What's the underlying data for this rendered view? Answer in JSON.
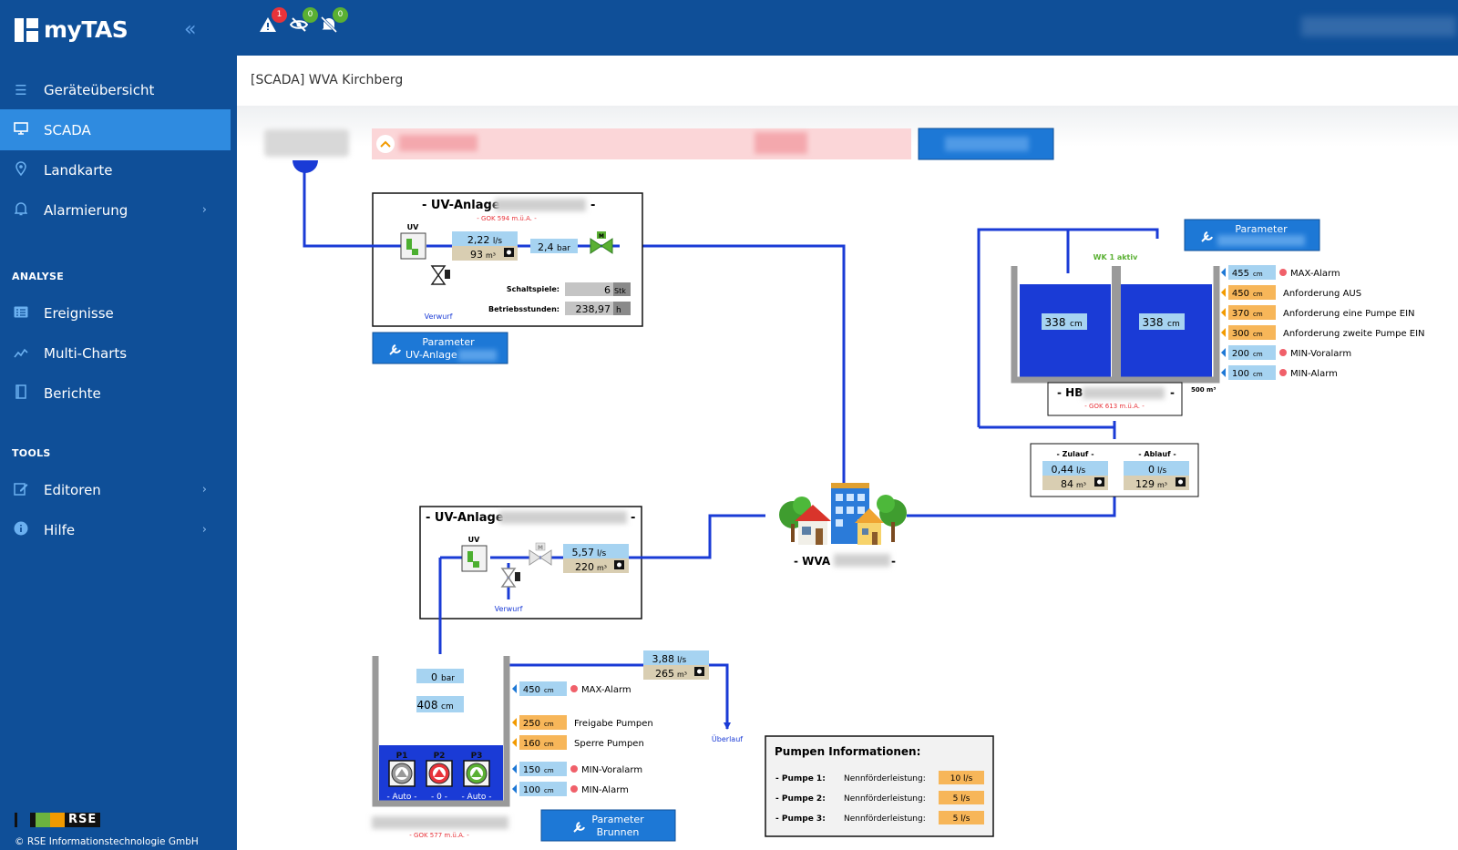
{
  "app": {
    "name": "myTAS"
  },
  "nav": {
    "items": [
      {
        "label": "Geräteübersicht"
      },
      {
        "label": "SCADA"
      },
      {
        "label": "Landkarte"
      },
      {
        "label": "Alarmierung"
      }
    ],
    "analyse_header": "ANALYSE",
    "analyse_items": [
      {
        "label": "Ereignisse"
      },
      {
        "label": "Multi-Charts"
      },
      {
        "label": "Berichte"
      }
    ],
    "tools_header": "TOOLS",
    "tools_items": [
      {
        "label": "Editoren"
      },
      {
        "label": "Hilfe"
      }
    ]
  },
  "footer": {
    "logo_text": "RSE",
    "copyright": "© RSE Informationstechnologie GmbH"
  },
  "topbar": {
    "alarm_count": "1",
    "hidden_count": "0",
    "muted_count": "0"
  },
  "page": {
    "title": "[SCADA] WVA Kirchberg"
  },
  "colors": {
    "brand": "#0f4f98",
    "active": "#2f8be0",
    "pipe": "#1a3bd6",
    "water": "#1a3bd6"
  },
  "uv1": {
    "title": "- UV-Anlage",
    "gok": "- GOK 594 m.ü.A. -",
    "uv_label": "UV",
    "flow": "2,22",
    "flow_unit": "l/s",
    "volume": "93",
    "volume_unit": "m³",
    "pressure": "2,4",
    "pressure_unit": "bar",
    "valve_label": "M",
    "verwurf": "Verwurf",
    "schaltspiele_label": "Schaltspiele:",
    "schaltspiele": "6",
    "schaltspiele_unit": "Stk",
    "betriebsstunden_label": "Betriebsstunden:",
    "betriebsstunden": "238,97",
    "betriebsstunden_unit": "h",
    "param_line1": "Parameter",
    "param_line2": "UV-Anlage"
  },
  "uv2": {
    "title": "- UV-Anlage",
    "uv_label": "UV",
    "valve_label": "M",
    "flow": "5,57",
    "flow_unit": "l/s",
    "volume": "220",
    "volume_unit": "m³",
    "verwurf": "Verwurf"
  },
  "hb": {
    "param_label": "Parameter",
    "wk_status": "WK 1 aktiv",
    "left_level": "338",
    "right_level": "338",
    "level_unit": "cm",
    "name": "- HB",
    "gok": "- GOK 613 m.ü.A. -",
    "capacity": "500 m³",
    "thresholds": [
      {
        "value": "455",
        "unit": "cm",
        "label": "MAX-Alarm",
        "type": "alarm"
      },
      {
        "value": "450",
        "unit": "cm",
        "label": "Anforderung AUS",
        "type": "control"
      },
      {
        "value": "370",
        "unit": "cm",
        "label": "Anforderung eine Pumpe EIN",
        "type": "control"
      },
      {
        "value": "300",
        "unit": "cm",
        "label": "Anforderung zweite Pumpe EIN",
        "type": "control"
      },
      {
        "value": "200",
        "unit": "cm",
        "label": "MIN-Voralarm",
        "type": "alarm"
      },
      {
        "value": "100",
        "unit": "cm",
        "label": "MIN-Alarm",
        "type": "alarm"
      }
    ],
    "zulauf_label": "- Zulauf -",
    "zulauf_flow": "0,44",
    "zulauf_volume": "84",
    "ablauf_label": "- Ablauf -",
    "ablauf_flow": "0",
    "ablauf_volume": "129",
    "flow_unit": "l/s",
    "volume_unit": "m³"
  },
  "wva": {
    "name": "- WVA"
  },
  "brunnen": {
    "pressure": "0",
    "pressure_unit": "bar",
    "level": "408",
    "level_unit": "cm",
    "pumps": [
      {
        "name": "P1",
        "state": "- Auto -",
        "color": "#9a9a9a"
      },
      {
        "name": "P2",
        "state": "- 0 -",
        "color": "#e8333a"
      },
      {
        "name": "P3",
        "state": "- Auto -",
        "color": "#5ab033"
      }
    ],
    "out_flow": "3,88",
    "out_flow_unit": "l/s",
    "out_volume": "265",
    "out_volume_unit": "m³",
    "ueberlauf": "Überlauf",
    "gok": "- GOK 577 m.ü.A. -",
    "thresholds": [
      {
        "value": "450",
        "unit": "cm",
        "label": "MAX-Alarm",
        "type": "alarm"
      },
      {
        "value": "250",
        "unit": "cm",
        "label": "Freigabe Pumpen",
        "type": "control"
      },
      {
        "value": "160",
        "unit": "cm",
        "label": "Sperre Pumpen",
        "type": "control"
      },
      {
        "value": "150",
        "unit": "cm",
        "label": "MIN-Voralarm",
        "type": "alarm"
      },
      {
        "value": "100",
        "unit": "cm",
        "label": "MIN-Alarm",
        "type": "alarm"
      }
    ],
    "param_line1": "Parameter",
    "param_line2": "Brunnen"
  },
  "pump_info": {
    "title": "Pumpen Informationen:",
    "rows": [
      {
        "pump": "- Pumpe 1:",
        "label": "Nennförderleistung:",
        "value": "10 l/s"
      },
      {
        "pump": "- Pumpe 2:",
        "label": "Nennförderleistung:",
        "value": "5 l/s"
      },
      {
        "pump": "- Pumpe 3:",
        "label": "Nennförderleistung:",
        "value": "5 l/s"
      }
    ]
  }
}
